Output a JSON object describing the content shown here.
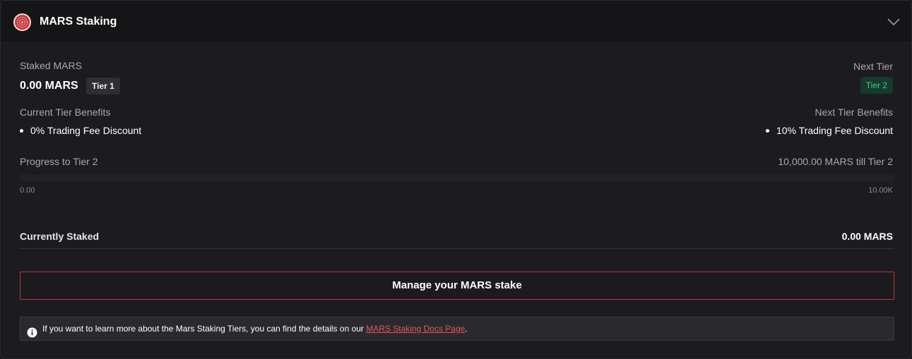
{
  "header": {
    "title": "MARS Staking",
    "logo_icon": "mars-token-icon",
    "collapse_icon": "chevron-down-icon"
  },
  "staked": {
    "label": "Staked MARS",
    "value": "0.00 MARS",
    "tier": "Tier 1"
  },
  "next_tier": {
    "label": "Next Tier",
    "tier": "Tier 2"
  },
  "benefits": {
    "current_label": "Current Tier Benefits",
    "current_items": [
      "0% Trading Fee Discount"
    ],
    "next_label": "Next Tier Benefits",
    "next_items": [
      "10% Trading Fee Discount"
    ]
  },
  "progress": {
    "label": "Progress to Tier 2",
    "remaining": "10,000.00 MARS till Tier 2",
    "min_label": "0.00",
    "max_label": "10.00K",
    "fraction": 0
  },
  "currently_staked": {
    "label": "Currently Staked",
    "value": "0.00 MARS"
  },
  "manage_button": "Manage your MARS stake",
  "info": {
    "icon": "info-icon",
    "text": "If you want to learn more about the Mars Staking Tiers, you can find the details on our ",
    "link_text": "MARS Staking Docs Page",
    "suffix": "."
  },
  "colors": {
    "accent": "#c63a3f",
    "link": "#e5575b",
    "next_tier_text": "#3ad28c",
    "next_tier_bg": "#163a2b"
  }
}
